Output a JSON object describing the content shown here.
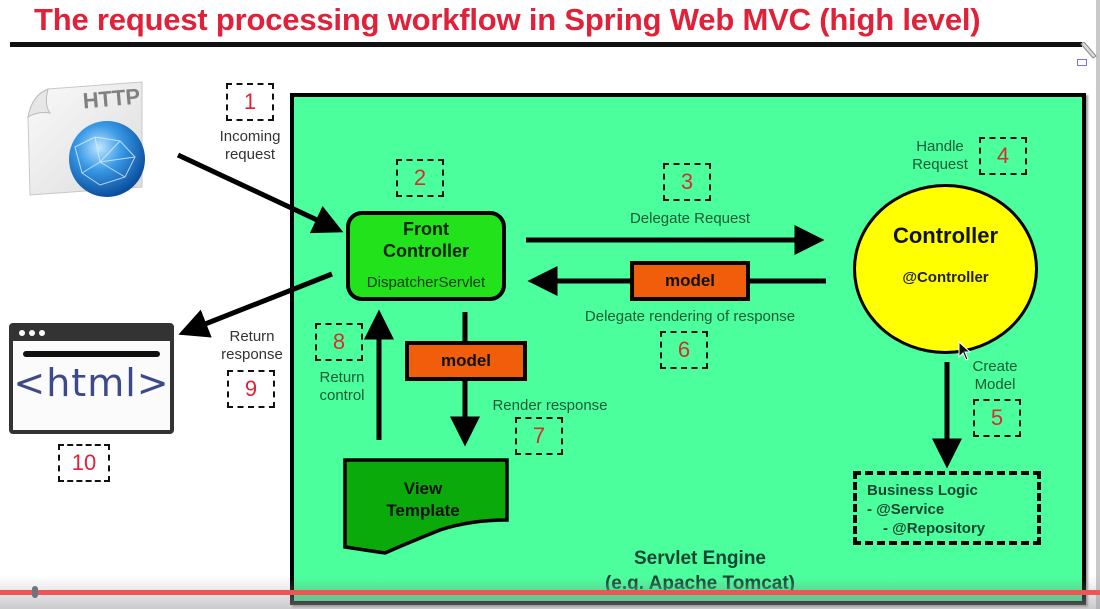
{
  "title": "The request processing workflow in Spring Web MVC (high level)",
  "colors": {
    "title": "#e0213a",
    "engine_bg": "#4bff9c",
    "front_controller": "#21e21b",
    "model": "#f05e0c",
    "controller": "#ffff00",
    "view_template": "#0aaa0a",
    "step_number": "#d42f2f",
    "progress": "#ee5555"
  },
  "client": {
    "http_icon_label": "HTTP",
    "browser_code": "<html>"
  },
  "steps": [
    {
      "number": "1",
      "label": "Incoming\nrequest"
    },
    {
      "number": "2",
      "label": ""
    },
    {
      "number": "3",
      "label": "Delegate Request"
    },
    {
      "number": "4",
      "label": "Handle\nRequest"
    },
    {
      "number": "5",
      "label": "Create\nModel"
    },
    {
      "number": "6",
      "label": "Delegate rendering of response"
    },
    {
      "number": "7",
      "label": "Render response"
    },
    {
      "number": "8",
      "label": "Return\ncontrol"
    },
    {
      "number": "9",
      "label": "Return\nresponse"
    },
    {
      "number": "10",
      "label": ""
    }
  ],
  "labels": {
    "incoming_1": "Incoming",
    "incoming_2": "request",
    "delegate_request": "Delegate Request",
    "handle_1": "Handle",
    "handle_2": "Request",
    "create_1": "Create",
    "create_2": "Model",
    "delegate_rendering": "Delegate rendering of response",
    "render_response": "Render response",
    "return_control_1": "Return",
    "return_control_2": "control",
    "return_response_1": "Return",
    "return_response_2": "response"
  },
  "front_controller": {
    "title_1": "Front",
    "title_2": "Controller",
    "subtitle": "DispatcherServlet"
  },
  "model_label": "model",
  "controller": {
    "title": "Controller",
    "annotation": "@Controller"
  },
  "business_logic": {
    "title": "Business Logic",
    "line_1": "- @Service",
    "line_2": "- @Repository"
  },
  "view_template": {
    "line_1": "View",
    "line_2": "Template"
  },
  "servlet_engine": {
    "line_1": "Servlet Engine",
    "line_2": "(e.g. Apache Tomcat)"
  },
  "video_progress": {
    "played_fraction": 0.03
  }
}
